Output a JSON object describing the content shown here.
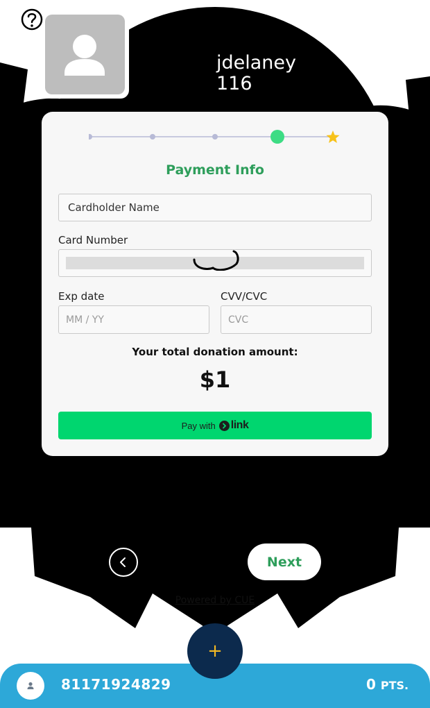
{
  "profile": {
    "username": "jdelaney",
    "user_id": "116"
  },
  "stepper": {
    "total_steps": 5,
    "current_step": 4,
    "active_color": "#3ddc84",
    "final_step_icon": "star-icon",
    "final_step_color": "#f7c21a"
  },
  "payment": {
    "title": "Payment Info",
    "cardholder_placeholder": "Cardholder Name",
    "card_number_label": "Card Number",
    "exp_label": "Exp date",
    "exp_placeholder": "MM / YY",
    "cvv_label": "CVV/CVC",
    "cvc_placeholder": "CVC",
    "total_label": "Your total donation amount:",
    "total_amount": "$1",
    "link_prefix": "Pay with",
    "link_brand": "link",
    "link_color": "#00d66f"
  },
  "nav": {
    "next_label": "Next",
    "powered_by": "Powered by CUE"
  },
  "footer": {
    "account_number": "81171924829",
    "points_value": "0",
    "points_unit": "PTS.",
    "bar_color": "#2da8d8"
  },
  "fab": {
    "icon": "plus-icon",
    "label": "+"
  },
  "colors": {
    "accent_green": "#2e9e5b",
    "fab_navy": "#0c2a4d",
    "fab_plus": "#f2b824"
  }
}
